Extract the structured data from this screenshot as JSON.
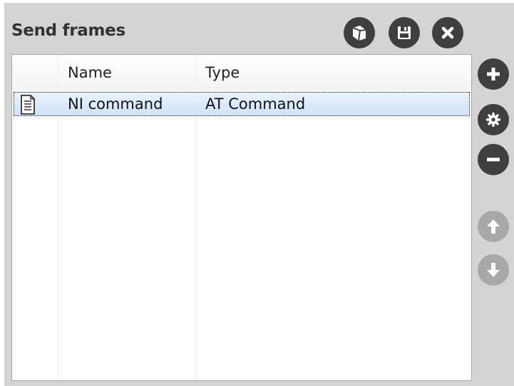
{
  "panel": {
    "title": "Send frames"
  },
  "toolbar": {
    "icons": [
      "load-icon",
      "save-icon",
      "close-icon"
    ]
  },
  "side_actions": {
    "icons": [
      "add-icon",
      "settings-icon",
      "remove-icon",
      "move-up-icon",
      "move-down-icon"
    ]
  },
  "table": {
    "columns": [
      "Name",
      "Type"
    ],
    "rows": [
      {
        "icon": "document-icon",
        "name": "NI command",
        "type": "AT Command",
        "selected": true
      }
    ]
  },
  "colors": {
    "panel_bg": "#d4d4d4",
    "button_dark": "#3f3f3f",
    "button_disabled": "#a8a8a8",
    "selection": "#d6e8fb"
  }
}
